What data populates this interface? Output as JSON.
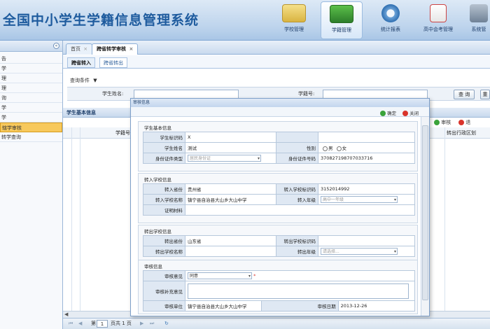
{
  "header": {
    "title": "全国中小学生学籍信息管理系统",
    "nav": [
      {
        "label": "学校管理",
        "icon": "school-building-icon"
      },
      {
        "label": "学籍管理",
        "icon": "student-records-icon"
      },
      {
        "label": "统计报表",
        "icon": "statistics-report-icon"
      },
      {
        "label": "高中会考管理",
        "icon": "exam-management-icon"
      },
      {
        "label": "系统管",
        "icon": "system-management-icon"
      }
    ]
  },
  "sidebar": {
    "collapse_glyph": "«",
    "items": [
      "告",
      "学",
      "理",
      "理",
      "询",
      "学",
      "学",
      "辖学审核",
      "转学查询"
    ],
    "selected_index": 7
  },
  "tabs": [
    {
      "label": "首页",
      "close": "×"
    },
    {
      "label": "跨省转学审核",
      "close": "×"
    }
  ],
  "subtabs": [
    "跨省转入",
    "跨省转出"
  ],
  "query": {
    "title": "查询条件",
    "arrow": "▼",
    "student_name_label": "学生姓名:",
    "student_no_label": "学籍号:",
    "search_button": "查 询",
    "reset_button": "重"
  },
  "grid": {
    "title": "学生基本信息",
    "approve_button": "审核",
    "reject_button": "退",
    "col_student_no": "学籍号",
    "col_transfer_area": "转出行政区划"
  },
  "pager": {
    "page_prefix": "第",
    "page_value": "1",
    "page_suffix": "页共 1 页",
    "first": "⏮",
    "prev": "◀",
    "next": "▶",
    "last": "⏭",
    "refresh": "↻"
  },
  "dialog": {
    "title": "审核信息",
    "ok_label": "确定",
    "close_label": "关闭",
    "student_section": {
      "title": "学生基本信息",
      "student_id_label": "学生标识码",
      "student_id_value": "X",
      "name_label": "学生姓名",
      "name_value": "测试",
      "gender_label": "性别",
      "gender_male": "男",
      "gender_female": "女",
      "id_type_label": "身份证件类型",
      "id_type_placeholder": "居民身份证",
      "id_no_label": "身份证件号码",
      "id_no_value": "370827198707033716"
    },
    "in_section": {
      "title": "转入学校信息",
      "province_label": "转入省份",
      "province_value": "贵州省",
      "school_code_label": "转入学校标识码",
      "school_code_value": "3152014992",
      "school_name_label": "转入学校名称",
      "school_name_value": "镇宁县自治县大山乡大山中学",
      "grade_label": "转入年级",
      "grade_placeholder": "高中一年级",
      "proof_label": "证明材料"
    },
    "out_section": {
      "title": "转出学校信息",
      "province_label": "转出省份",
      "province_value": "山东省",
      "school_code_label": "转出学校标识码",
      "school_code_value": "",
      "school_name_label": "转出学校名称",
      "school_name_value": "",
      "grade_label": "转出年级",
      "grade_placeholder": "请选择..."
    },
    "review_section": {
      "title": "审核信息",
      "opinion_label": "审核意见",
      "opinion_value": "同意",
      "required_mark": "*",
      "supplement_label": "审核补充意见",
      "unit_label": "审核单位",
      "unit_value": "镇宁县自治县大山乡大山中学",
      "date_label": "审核日期",
      "date_value": "2013-12-26"
    }
  },
  "colors": {
    "brand_blue": "#1e5b9e",
    "selected_item": "#f7c95c",
    "ok_green": "#3aa33a",
    "close_red": "#d9342b"
  }
}
